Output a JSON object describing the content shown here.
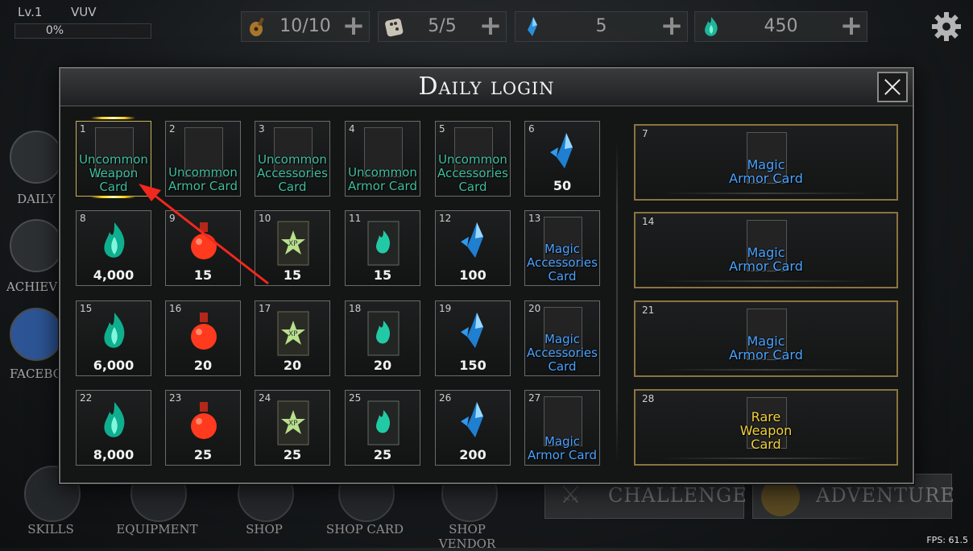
{
  "hud": {
    "level": "Lv.1",
    "username": "VUV",
    "xp_percent": "0%",
    "xp_fraction": 0.0,
    "resources": [
      {
        "icon": "lute-energy-icon",
        "value": "10/10"
      },
      {
        "icon": "dice-icon",
        "value": "5/5"
      },
      {
        "icon": "blue-crystal-icon",
        "value": "5"
      },
      {
        "icon": "green-soul-flame-icon",
        "value": "450"
      }
    ],
    "settings_icon": "gear-icon"
  },
  "side_menu": [
    {
      "label": "DAILY",
      "icon": "book-icon"
    },
    {
      "label": "ACHIEVE",
      "icon": "trophy-icon"
    },
    {
      "label": "FACEBO",
      "icon": "facebook-icon"
    }
  ],
  "bottom_menu": [
    {
      "label": "SKILLS",
      "icon": "knight-helmet-icon"
    },
    {
      "label": "EQUIPMENT",
      "icon": "armor-icon"
    },
    {
      "label": "SHOP",
      "icon": "shop-icon"
    },
    {
      "label": "SHOP CARD",
      "icon": "card-shop-icon"
    },
    {
      "label": "SHOP VENDOR",
      "icon": "vendor-icon"
    }
  ],
  "buttons": {
    "challenge": "CHALLENGE",
    "adventure": "ADVENTURE"
  },
  "fps": "FPS: 61.5",
  "dialog": {
    "title": "Daily login",
    "days": [
      {
        "day": "1",
        "label": "Uncommon Weapon Card",
        "rarity": "uncommon",
        "type": "card",
        "selected": true
      },
      {
        "day": "2",
        "label": "Uncommon Armor Card",
        "rarity": "uncommon",
        "type": "card"
      },
      {
        "day": "3",
        "label": "Uncommon Accessories Card",
        "rarity": "uncommon",
        "type": "card"
      },
      {
        "day": "4",
        "label": "Uncommon Armor Card",
        "rarity": "uncommon",
        "type": "card"
      },
      {
        "day": "5",
        "label": "Uncommon Accessories Card",
        "rarity": "uncommon",
        "type": "card"
      },
      {
        "day": "6",
        "qty": "50",
        "type": "crystal"
      },
      {
        "day": "8",
        "qty": "4,000",
        "type": "soul"
      },
      {
        "day": "9",
        "qty": "15",
        "type": "potion"
      },
      {
        "day": "10",
        "qty": "15",
        "type": "xp"
      },
      {
        "day": "11",
        "qty": "15",
        "type": "soulcard"
      },
      {
        "day": "12",
        "qty": "100",
        "type": "crystal"
      },
      {
        "day": "13",
        "label": "Magic Accessories Card",
        "rarity": "magic",
        "type": "card"
      },
      {
        "day": "15",
        "qty": "6,000",
        "type": "soul"
      },
      {
        "day": "16",
        "qty": "20",
        "type": "potion"
      },
      {
        "day": "17",
        "qty": "20",
        "type": "xp"
      },
      {
        "day": "18",
        "qty": "20",
        "type": "soulcard"
      },
      {
        "day": "19",
        "qty": "150",
        "type": "crystal"
      },
      {
        "day": "20",
        "label": "Magic Accessories Card",
        "rarity": "magic",
        "type": "card"
      },
      {
        "day": "22",
        "qty": "8,000",
        "type": "soul"
      },
      {
        "day": "23",
        "qty": "25",
        "type": "potion"
      },
      {
        "day": "24",
        "qty": "25",
        "type": "xp"
      },
      {
        "day": "25",
        "qty": "25",
        "type": "soulcard"
      },
      {
        "day": "26",
        "qty": "200",
        "type": "crystal"
      },
      {
        "day": "27",
        "label": "Magic Armor Card",
        "rarity": "magic",
        "type": "card"
      }
    ],
    "weekly": [
      {
        "day": "7",
        "label": "Magic Armor Card",
        "rarity": "magic"
      },
      {
        "day": "14",
        "label": "Magic Armor Card",
        "rarity": "magic"
      },
      {
        "day": "21",
        "label": "Magic Armor Card",
        "rarity": "magic"
      },
      {
        "day": "28",
        "label": "Rare Weapon Card",
        "rarity": "rare"
      }
    ]
  },
  "colors": {
    "uncommon": "#3fbf9f",
    "magic": "#4aa3ff",
    "rare": "#f3d33e",
    "weekly_border": "#8a7440"
  }
}
